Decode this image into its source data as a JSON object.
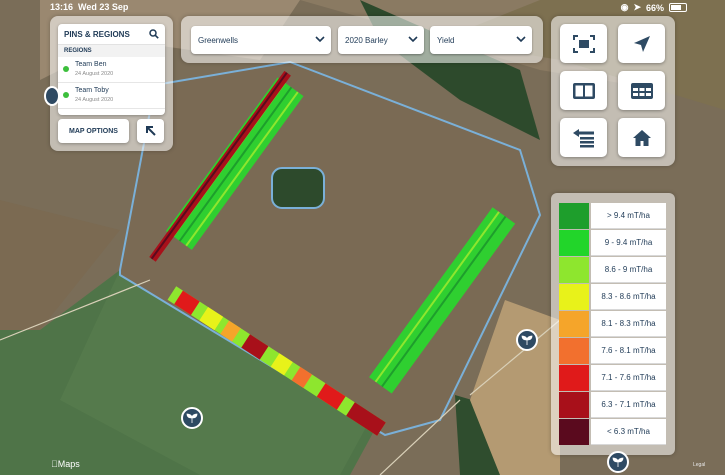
{
  "status": {
    "time": "13:16",
    "date": "Wed 23 Sep",
    "battery": "66%"
  },
  "pins": {
    "title": "PINS & REGIONS",
    "regions_header": "REGIONS",
    "regions": [
      {
        "name": "Team Ben",
        "date": "24 August 2020"
      },
      {
        "name": "Team Toby",
        "date": "24 August 2020"
      }
    ],
    "map_options": "MAP OPTIONS"
  },
  "filters": {
    "farm": "Greenwells",
    "crop": "2020 Barley",
    "layer": "Yield"
  },
  "toolbar": [
    "fit-view-icon",
    "locate-arrow-icon",
    "split-view-icon",
    "table-icon",
    "layers-swap-icon",
    "home-icon"
  ],
  "legend": [
    {
      "label": "> 9.4 mT/ha",
      "color": "#1e9e2c"
    },
    {
      "label": "9 - 9.4 mT/ha",
      "color": "#22d52a"
    },
    {
      "label": "8.6 - 9 mT/ha",
      "color": "#8ee62e"
    },
    {
      "label": "8.3 - 8.6 mT/ha",
      "color": "#e8f21a"
    },
    {
      "label": "8.1 - 8.3 mT/ha",
      "color": "#f5a52a"
    },
    {
      "label": "7.6 - 8.1 mT/ha",
      "color": "#f2702e"
    },
    {
      "label": "7.1 - 7.6 mT/ha",
      "color": "#e01a1a"
    },
    {
      "label": "6.3 - 7.1 mT/ha",
      "color": "#a8101a"
    },
    {
      "label": "< 6.3 mT/ha",
      "color": "#5a0a1e"
    }
  ],
  "map_brand": "Maps",
  "legal_text": "Legal"
}
